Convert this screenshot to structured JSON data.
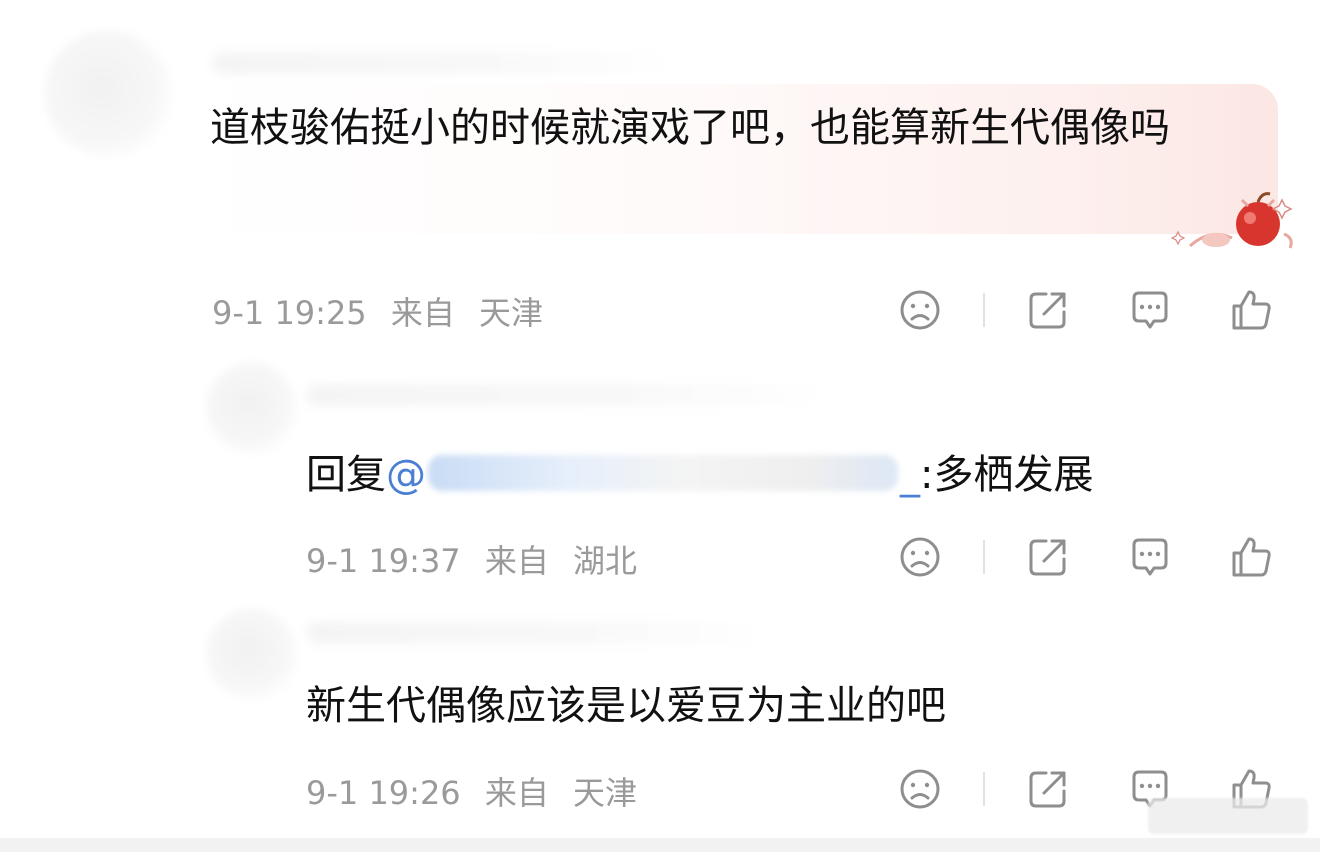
{
  "comments": [
    {
      "text": "道枝骏佑挺小的时候就演戏了吧，也能算新生代偶像吗",
      "time": "9-1 19:25",
      "from_label": "来自",
      "location": "天津"
    }
  ],
  "replies": [
    {
      "reply_prefix": "回复",
      "mention_at": "@",
      "mention_tail": "_",
      "text": ":多栖发展",
      "time": "9-1 19:37",
      "from_label": "来自",
      "location": "湖北"
    },
    {
      "text": "新生代偶像应该是以爱豆为主业的吧",
      "time": "9-1 19:26",
      "from_label": "来自",
      "location": "天津"
    }
  ],
  "icons": {
    "dislike": "sad-face-icon",
    "share": "share-icon",
    "comment": "comment-icon",
    "like": "thumbs-up-icon"
  },
  "colors": {
    "meta_text": "#9a9a9a",
    "mention": "#4a7fd4",
    "bubble_tint": "#fbe7e4"
  }
}
